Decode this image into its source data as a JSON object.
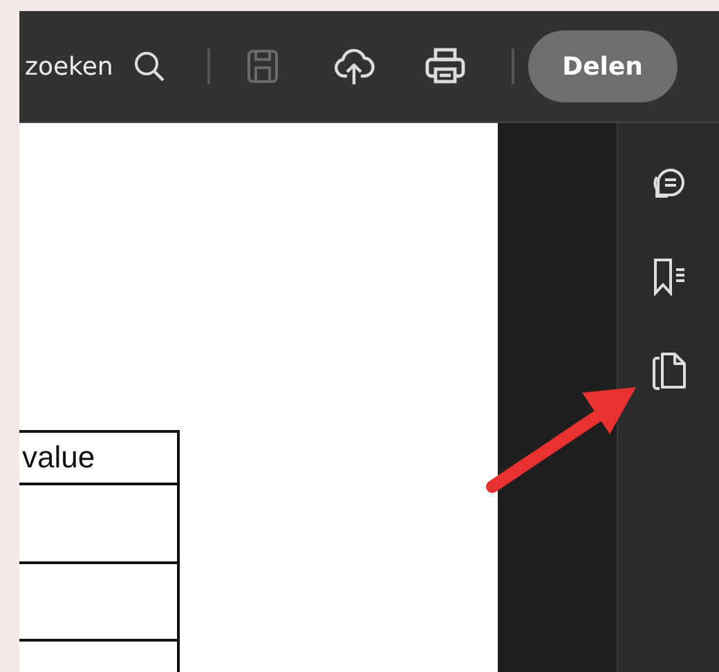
{
  "toolbar": {
    "search_label": "zoeken",
    "tools": [
      {
        "kind": "save",
        "disabled": true
      },
      {
        "kind": "upload",
        "disabled": false
      },
      {
        "kind": "print",
        "disabled": false
      }
    ],
    "share_button": "Delen"
  },
  "document": {
    "table": {
      "header": "value"
    }
  },
  "sidebar": {
    "tools": [
      {
        "kind": "comment"
      },
      {
        "kind": "bookmarks"
      },
      {
        "kind": "pages"
      }
    ]
  }
}
